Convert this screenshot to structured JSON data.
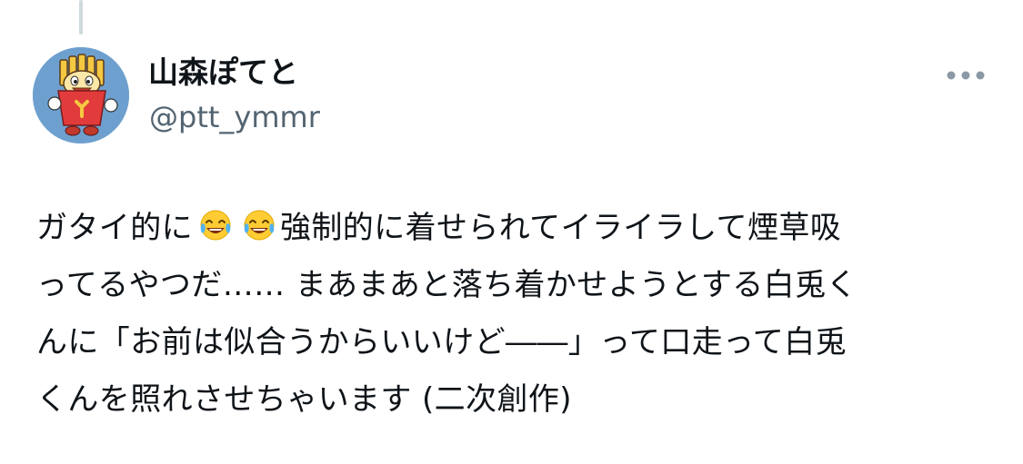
{
  "author": {
    "display_name": "山森ぽてと",
    "handle": "@ptt_ymmr",
    "avatar_icon": "fries-mascot-avatar"
  },
  "more_button_icon": "more-horizontal-icon",
  "tweet": {
    "line1": {
      "before": "ガタイ的に",
      "emojis": [
        "face-with-tears-of-joy-emoji",
        "face-with-tears-of-joy-emoji"
      ],
      "after": "強制的に着せられてイライラして煙草吸"
    },
    "line2": "ってるやつだ…… まあまあと落ち着かせようとする白兎く",
    "line3": "んに「お前は似合うからいいけど――」って口走って白兎",
    "line4": "くんを照れさせちゃいます (二次創作)"
  },
  "colors": {
    "text": "#0f1419",
    "secondary": "#536471",
    "thread_line": "#cfd9de",
    "avatar_bg": "#6ea0cf",
    "dots": "#8b98a5"
  }
}
